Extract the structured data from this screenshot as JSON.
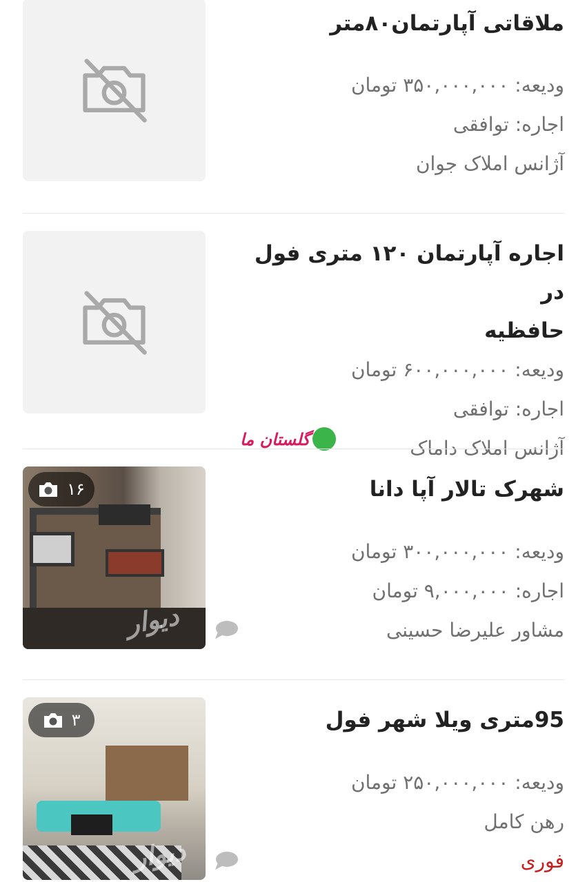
{
  "listings": [
    {
      "title": "ملاقاتی آپارتمان۸۰متر",
      "deposit": "ودیعه: ۳۵۰,۰۰۰,۰۰۰ تومان",
      "rent": "اجاره: توافقی",
      "agency": "آژانس املاک جوان",
      "image": "no-image-icon"
    },
    {
      "title_line1": "اجاره آپارتمان ۱۲۰ متری فول در",
      "title_line2": "حافظیه",
      "deposit": "ودیعه: ۶۰۰,۰۰۰,۰۰۰ تومان",
      "rent": "اجاره: توافقی",
      "agency": "آژانس املاک داماک",
      "image": "no-image-icon"
    },
    {
      "title": "شهرک تالار  آپا دانا",
      "deposit": "ودیعه: ۳۰۰,۰۰۰,۰۰۰ تومان",
      "rent": "اجاره: ۹,۰۰۰,۰۰۰ تومان",
      "agency": "مشاور علیرضا حسینی",
      "photo_count": "۱۶",
      "watermark": "دیوار"
    },
    {
      "title": "95متری ویلا شهر فول",
      "deposit": "ودیعه: ۲۵۰,۰۰۰,۰۰۰ تومان",
      "rent": "رهن کامل",
      "tag": "فوری",
      "photo_count": "۳",
      "watermark": "دیوار"
    }
  ],
  "brand_watermark": "گلستان ما",
  "colors": {
    "urgent": "#c81e1e",
    "muted": "#707070",
    "title": "#222222"
  }
}
